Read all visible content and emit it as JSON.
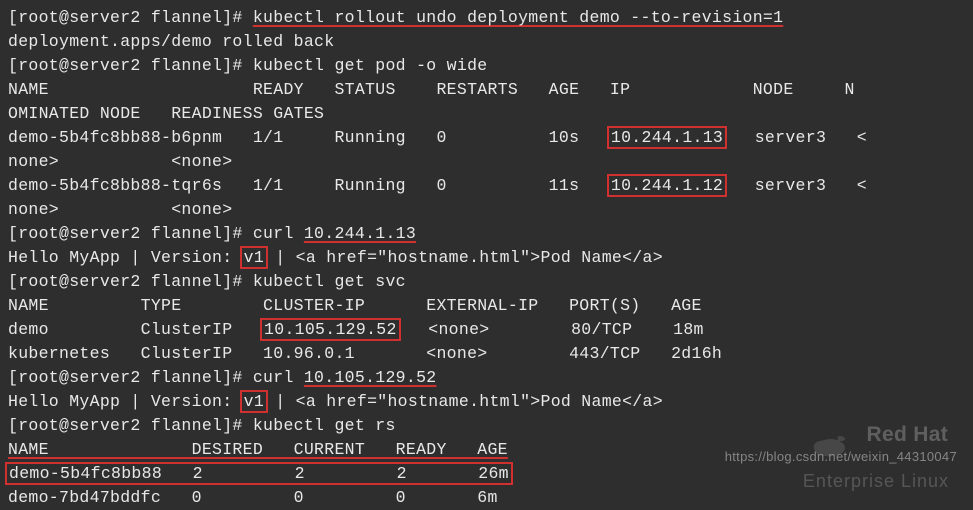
{
  "prompt": "[root@server2 flannel]# ",
  "cmd1": "kubectl rollout undo deployment demo --to-revision=1",
  "out1": "deployment.apps/demo rolled back",
  "cmd2": "kubectl get pod -o wide",
  "pods": {
    "hdr1": "NAME                    READY   STATUS    RESTARTS   AGE   IP            NODE     N",
    "hdr2": "OMINATED NODE   READINESS GATES",
    "row1a": "demo-5b4fc8bb88-b6pnm   1/1     Running   0          10s   ",
    "row1_ip": "10.244.1.13",
    "row1b": "   server3   <",
    "row2": "none>           <none>",
    "row3a": "demo-5b4fc8bb88-tqr6s   1/1     Running   0          11s   ",
    "row3_ip": "10.244.1.12",
    "row3b": "   server3   <",
    "row4": "none>           <none>"
  },
  "cmd3a": "curl ",
  "cmd3b": "10.244.1.13",
  "curl1a": "Hello MyApp | Version: ",
  "curl1_v": "v1",
  "curl1b": " | <a href=\"hostname.html\">Pod Name</a>",
  "cmd4": "kubectl get svc",
  "svc": {
    "hdr": "NAME         TYPE        CLUSTER-IP      EXTERNAL-IP   PORT(S)   AGE",
    "row1a": "demo         ClusterIP   ",
    "row1_ip": "10.105.129.52",
    "row1b": "   <none>        80/TCP    18m",
    "row2": "kubernetes   ClusterIP   10.96.0.1       <none>        443/TCP   2d16h"
  },
  "cmd5a": "curl ",
  "cmd5b": "10.105.129.52",
  "curl2a": "Hello MyApp | Version: ",
  "curl2_v": "v1",
  "curl2b": " | <a href=\"hostname.html\">Pod Name</a>",
  "cmd6": "kubectl get rs",
  "rs": {
    "hdr": "NAME              DESIRED   CURRENT   READY   AGE",
    "row1": "demo-5b4fc8bb88   2         2         2       26m",
    "row2": "demo-7bd47bddfc   0         0         0       6m"
  },
  "watermark_brand": "Red Hat",
  "watermark_sub": "Enterprise Linux",
  "watermark_url": "https://blog.csdn.net/weixin_44310047"
}
